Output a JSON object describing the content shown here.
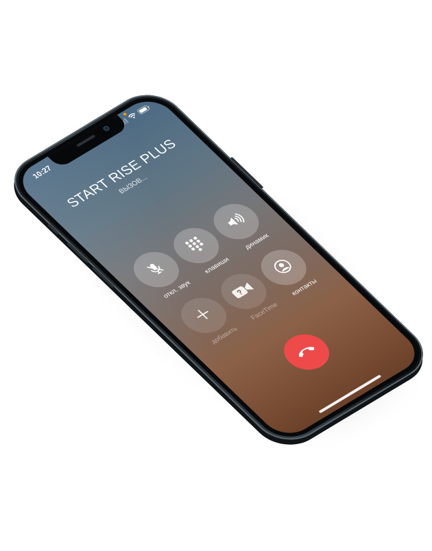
{
  "status_bar": {
    "time": "10:27",
    "icons": [
      "signal-icon",
      "wifi-icon",
      "battery-icon"
    ]
  },
  "call": {
    "caller_name": "START RISE PLUS",
    "status": "ВЫЗОВ..."
  },
  "controls": [
    {
      "id": "mute",
      "label": "откл. звук",
      "icon": "microphone-off-icon",
      "enabled": true
    },
    {
      "id": "keypad",
      "label": "клавиши",
      "icon": "keypad-icon",
      "enabled": true
    },
    {
      "id": "speaker",
      "label": "динамик",
      "icon": "speaker-icon",
      "enabled": true
    },
    {
      "id": "add",
      "label": "добавить",
      "icon": "plus-icon",
      "enabled": false
    },
    {
      "id": "facetime",
      "label": "FaceTime",
      "icon": "facetime-icon",
      "enabled": false
    },
    {
      "id": "contacts",
      "label": "контакты",
      "icon": "contacts-icon",
      "enabled": true
    }
  ],
  "end_call": {
    "icon": "phone-hangup-icon",
    "color": "#ee4a4a"
  },
  "colors": {
    "screen_top": "#4c6a84",
    "screen_bottom": "#6b4129",
    "button_fill": "rgba(255,255,255,0.24)"
  }
}
